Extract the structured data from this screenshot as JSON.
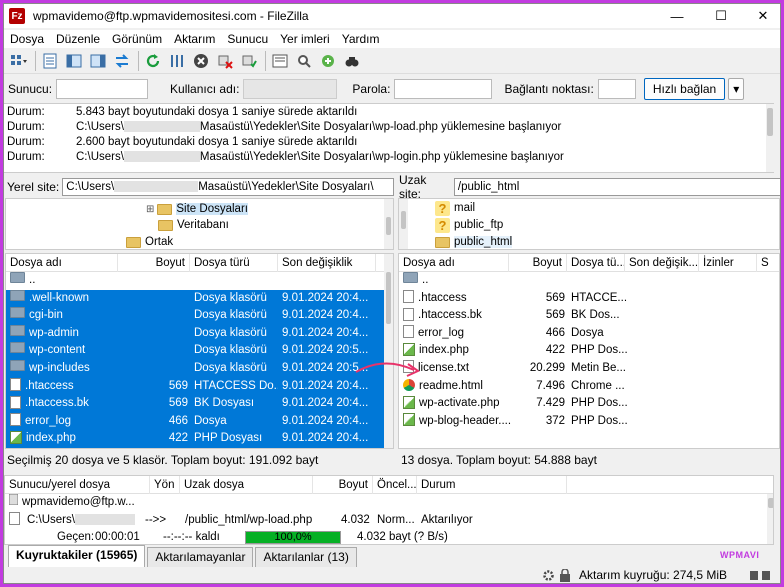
{
  "window": {
    "title": "wpmavidemo@ftp.wpmavidemositesi.com - FileZilla",
    "app_icon": "Fz",
    "minimize": "—",
    "maximize": "☐",
    "close": "✕"
  },
  "menu": [
    "Dosya",
    "Düzenle",
    "Görünüm",
    "Aktarım",
    "Sunucu",
    "Yer imleri",
    "Yardım"
  ],
  "quickconnect": {
    "host_label": "Sunucu:",
    "user_label": "Kullanıcı adı:",
    "pass_label": "Parola:",
    "port_label": "Bağlantı noktası:",
    "connect_button": "Hızlı bağlan",
    "dropdown_arrow": "▾"
  },
  "log": [
    {
      "k": "Durum:",
      "v": "5.843 bayt boyutundaki dosya 1 saniye sürede aktarıldı"
    },
    {
      "k": "Durum:",
      "v1": "C:\\Users\\",
      "v2": "Masaüstü\\Yedekler\\Site Dosyaları\\wp-load.php yüklemesine başlanıyor"
    },
    {
      "k": "Durum:",
      "v": "2.600 bayt boyutundaki dosya 1 saniye sürede aktarıldı"
    },
    {
      "k": "Durum:",
      "v1": "C:\\Users\\",
      "v2": "Masaüstü\\Yedekler\\Site Dosyaları\\wp-login.php yüklemesine başlanıyor"
    }
  ],
  "local": {
    "label": "Yerel site:",
    "path1": "C:\\Users\\",
    "path2": "Masaüstü\\Yedekler\\Site Dosyaları\\",
    "tree": [
      "Site Dosyaları",
      "Veritabanı",
      "Ortak"
    ],
    "expander": "⊞",
    "headers": [
      "Dosya adı",
      "Boyut",
      "Dosya türü",
      "Son değişiklik"
    ],
    "rows": [
      {
        "name": "..",
        "size": "",
        "type": "",
        "date": "",
        "icon": "folder",
        "sel": false
      },
      {
        "name": ".well-known",
        "size": "",
        "type": "Dosya klasörü",
        "date": "9.01.2024 20:4...",
        "icon": "folder",
        "sel": true
      },
      {
        "name": "cgi-bin",
        "size": "",
        "type": "Dosya klasörü",
        "date": "9.01.2024 20:4...",
        "icon": "folder",
        "sel": true
      },
      {
        "name": "wp-admin",
        "size": "",
        "type": "Dosya klasörü",
        "date": "9.01.2024 20:4...",
        "icon": "folder",
        "sel": true
      },
      {
        "name": "wp-content",
        "size": "",
        "type": "Dosya klasörü",
        "date": "9.01.2024 20:5...",
        "icon": "folder",
        "sel": true
      },
      {
        "name": "wp-includes",
        "size": "",
        "type": "Dosya klasörü",
        "date": "9.01.2024 20:5...",
        "icon": "folder",
        "sel": true
      },
      {
        "name": ".htaccess",
        "size": "569",
        "type": "HTACCESS Do...",
        "date": "9.01.2024 20:4...",
        "icon": "file",
        "sel": true
      },
      {
        "name": ".htaccess.bk",
        "size": "569",
        "type": "BK Dosyası",
        "date": "9.01.2024 20:4...",
        "icon": "file",
        "sel": true
      },
      {
        "name": "error_log",
        "size": "466",
        "type": "Dosya",
        "date": "9.01.2024 20:4...",
        "icon": "file",
        "sel": true
      },
      {
        "name": "index.php",
        "size": "422",
        "type": "PHP Dosyası",
        "date": "9.01.2024 20:4...",
        "icon": "php",
        "sel": true
      }
    ],
    "status": "Seçilmiş 20 dosya ve 5 klasör. Toplam boyut: 191.092 bayt"
  },
  "remote": {
    "label": "Uzak site:",
    "path": "/public_html",
    "tree": [
      "mail",
      "public_ftp",
      "public_html"
    ],
    "headers": [
      "Dosya adı",
      "Boyut",
      "Dosya tü...",
      "Son değişik...",
      "İzinler",
      "S"
    ],
    "rows": [
      {
        "name": "..",
        "size": "",
        "type": "",
        "icon": "folder"
      },
      {
        "name": ".htaccess",
        "size": "569",
        "type": "HTACCE...",
        "icon": "file"
      },
      {
        "name": ".htaccess.bk",
        "size": "569",
        "type": "BK Dos...",
        "icon": "file"
      },
      {
        "name": "error_log",
        "size": "466",
        "type": "Dosya",
        "icon": "file"
      },
      {
        "name": "index.php",
        "size": "422",
        "type": "PHP Dos...",
        "icon": "php"
      },
      {
        "name": "license.txt",
        "size": "20.299",
        "type": "Metin Be...",
        "icon": "file"
      },
      {
        "name": "readme.html",
        "size": "7.496",
        "type": "Chrome ...",
        "icon": "chrome"
      },
      {
        "name": "wp-activate.php",
        "size": "7.429",
        "type": "PHP Dos...",
        "icon": "php"
      },
      {
        "name": "wp-blog-header....",
        "size": "372",
        "type": "PHP Dos...",
        "icon": "php"
      }
    ],
    "status": "13 dosya. Toplam boyut: 54.888 bayt"
  },
  "queue": {
    "headers": [
      "Sunucu/yerel dosya",
      "Yön",
      "Uzak dosya",
      "Boyut",
      "Öncel...",
      "Durum"
    ],
    "server": "wpmavidemo@ftp.w...",
    "local_file": "C:\\Users\\",
    "direction": "-->>",
    "remote_file": "/public_html/wp-load.php",
    "size": "4.032",
    "priority": "Norm...",
    "state": "Aktarılıyor",
    "elapsed_label": "Geçen:",
    "elapsed": "00:00:01",
    "remaining": "--:--:-- kaldı",
    "progress_text": "100,0%",
    "progress": 1.0,
    "bytes": "4.032 bayt (? B/s)"
  },
  "tabs": [
    "Kuyruktakiler (15965)",
    "Aktarılamayanlar",
    "Aktarılanlar (13)"
  ],
  "statusbar": {
    "queue": "Aktarım kuyruğu: 274,5 MiB"
  },
  "watermark": "WPMAVI",
  "colors": {
    "selection": "#0078d7",
    "progress": "#06b025",
    "border": "#c23be0",
    "arrow": "#e8336a"
  }
}
